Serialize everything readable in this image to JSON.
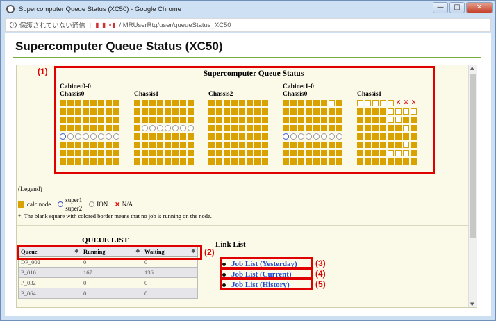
{
  "window": {
    "title": "Supercomputer Queue Status (XC50) - Google Chrome",
    "controls": [
      "minimize-icon",
      "maximize-icon",
      "close-icon"
    ]
  },
  "addressbar": {
    "security_text": "保護されていない通信",
    "url": "/IMRUserRtg/user/queueStatus_XC50"
  },
  "page": {
    "title": "Supercomputer Queue Status (XC50)"
  },
  "status": {
    "title": "Supercomputer Queue Status",
    "cabinet0": "Cabinet0-0",
    "cabinet1": "Cabinet1-0",
    "chassis": [
      {
        "label": "Chassis0",
        "rows": [
          "ffffffff",
          "ffffffff",
          "ffffffff",
          "ffffffff",
          "booooooo",
          "ffffffff",
          "ffffffff",
          "ffffffff"
        ]
      },
      {
        "label": "Chassis1",
        "rows": [
          "ffffffff",
          "ffffffff",
          "ffffffff",
          "fooooooo",
          "ffffffff",
          "ffffffff",
          "ffffffff",
          "ffffffff"
        ]
      },
      {
        "label": "Chassis2",
        "rows": [
          "ffffffff",
          "ffffffff",
          "ffffffff",
          "ffffffff",
          "ffffffff",
          "ffffffff",
          "ffffffff",
          "ffffffff"
        ]
      },
      {
        "label": "Chassis0",
        "rows": [
          "ffffffef",
          "ffffffff",
          "ffffffff",
          "ffffffff",
          "booooooo",
          "ffffffff",
          "ffffffff",
          "ffffffff"
        ]
      },
      {
        "label": "Chassis1",
        "rows": [
          "eeeeexxx",
          "ffffeeee",
          "ffffeeff",
          "ffffffef",
          "ffffffff",
          "ffffffef",
          "ffffeeef",
          "ffffffff"
        ]
      }
    ]
  },
  "legend": {
    "heading": "(Legend)",
    "calc": "calc node",
    "super1": "super1",
    "super2": "super2",
    "ion": "ION",
    "na": "N/A",
    "note": "*: The blank square with colored border means that no job is running on the node."
  },
  "queue": {
    "title": "QUEUE LIST",
    "columns": [
      "Queue",
      "Running",
      "Waiting"
    ],
    "rows": [
      [
        "DP_002",
        "0",
        "0"
      ],
      [
        "P_016",
        "167",
        "136"
      ],
      [
        "P_032",
        "0",
        "0"
      ],
      [
        "P_064",
        "0",
        "0"
      ]
    ]
  },
  "links": {
    "title": "Link List",
    "items": [
      "Job List (Yesterday)",
      "Job List (Current)",
      "Job List (History)"
    ]
  },
  "annotations": [
    "(1)",
    "(2)",
    "(3)",
    "(4)",
    "(5)"
  ],
  "colors": {
    "node": "#d9a200",
    "highlight": "#e00000",
    "link": "#1a49d1",
    "accent": "#7aaa3a"
  }
}
